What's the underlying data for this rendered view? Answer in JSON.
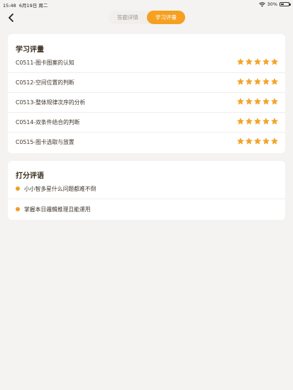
{
  "status_bar": {
    "time": "15:48",
    "date": "6月19日 周二",
    "battery_percent": "30%",
    "battery_level": 0.3
  },
  "nav": {
    "tabs": [
      {
        "label": "答题详情",
        "active": false
      },
      {
        "label": "学习评量",
        "active": true
      }
    ],
    "accent_color": "#f5a021"
  },
  "evaluation": {
    "title": "学习评量",
    "items": [
      {
        "label": "C0511-图卡图案的认知",
        "stars": 5
      },
      {
        "label": "C0512-空间位置的判断",
        "stars": 5
      },
      {
        "label": "C0513-整体规律次序的分析",
        "stars": 5
      },
      {
        "label": "C0514-双条件结合的判断",
        "stars": 5
      },
      {
        "label": "C0515-图卡选取与放置",
        "stars": 5
      }
    ]
  },
  "comments": {
    "title": "打分评语",
    "items": [
      {
        "text": "小小智多星什么问题都难不倒"
      },
      {
        "text": "掌握本日邏輯推理且能運用"
      }
    ]
  }
}
